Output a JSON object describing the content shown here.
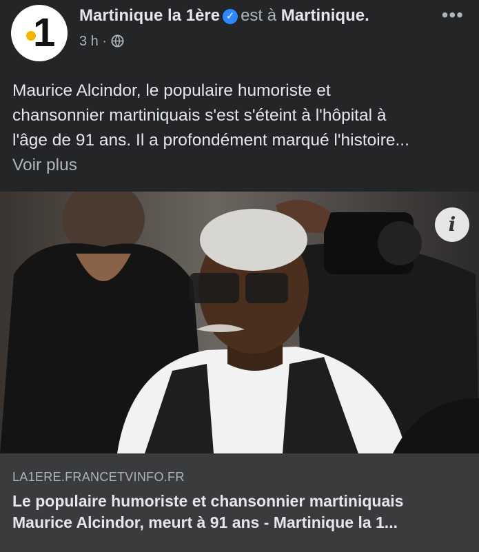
{
  "header": {
    "page_name": "Martinique la 1ère",
    "verified_icon": "verified-check-icon",
    "action_text": "est à",
    "location": "Martinique.",
    "timestamp": "3 h",
    "separator": "·",
    "audience_icon": "globe-icon",
    "more_icon": "•••",
    "avatar_text": "1"
  },
  "post": {
    "text_lines": [
      "Maurice Alcindor, le populaire humoriste et",
      "chansonnier martiniquais s'est s'éteint à l'hôpital à",
      "l'âge de 91 ans. Il a profondément marqué l'histoire..."
    ],
    "see_more": "Voir plus"
  },
  "photo": {
    "info_icon": "i"
  },
  "link_card": {
    "domain": "LA1ERE.FRANCETVINFO.FR",
    "title_lines": [
      "Le populaire humoriste et chansonnier martiniquais",
      "Maurice Alcindor, meurt à 91 ans - Martinique la 1..."
    ]
  },
  "colors": {
    "background": "#242526",
    "card": "#3a3b3c",
    "verified": "#2d88ff",
    "logo_dot": "#f5b400"
  }
}
